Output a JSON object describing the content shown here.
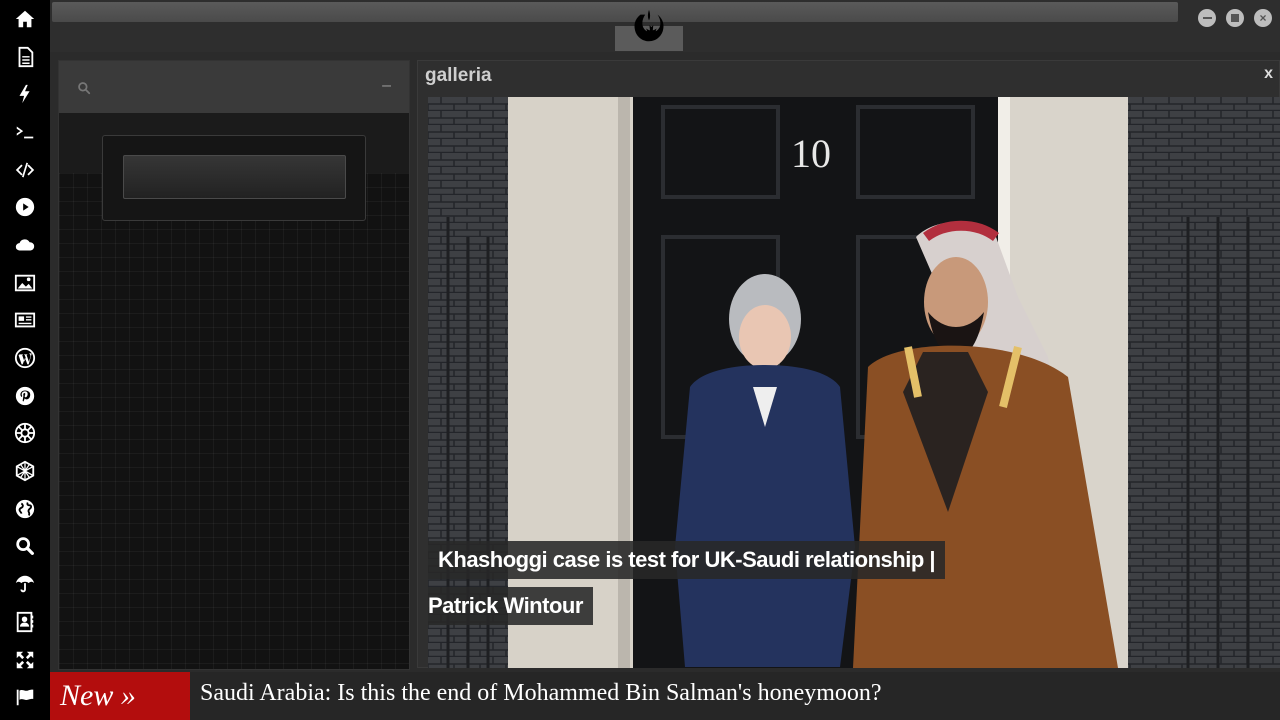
{
  "dock": {
    "items": [
      {
        "name": "home-icon"
      },
      {
        "name": "document-icon"
      },
      {
        "name": "bolt-icon"
      },
      {
        "name": "terminal-icon"
      },
      {
        "name": "code-icon"
      },
      {
        "name": "play-icon"
      },
      {
        "name": "cloud-icon"
      },
      {
        "name": "image-icon"
      },
      {
        "name": "newspaper-icon"
      },
      {
        "name": "wordpress-icon"
      },
      {
        "name": "pinterest-icon"
      },
      {
        "name": "empire-icon"
      },
      {
        "name": "network-icon"
      },
      {
        "name": "globe-icon"
      },
      {
        "name": "search-icon"
      },
      {
        "name": "umbrella-icon"
      },
      {
        "name": "contacts-icon"
      },
      {
        "name": "expand-icon"
      },
      {
        "name": "flag-icon"
      }
    ]
  },
  "topbar": {
    "logo": "rebel-alliance-icon",
    "window_controls": [
      "minimize-icon",
      "maximize-icon",
      "close-icon"
    ]
  },
  "search_panel": {
    "placeholder": "",
    "minimize_label": "–"
  },
  "gallery": {
    "title": "galleria",
    "close_label": "x",
    "caption_line1": "Khashoggi case is test for UK-Saudi relationship |",
    "caption_line2": "Patrick Wintour",
    "door_number": "10"
  },
  "ticker": {
    "badge": "New »",
    "headline": "Saudi Arabia: Is this the end of Mohammed Bin Salman's honeymoon?"
  },
  "colors": {
    "accent_red": "#b30d0d",
    "dock_bg": "#000000",
    "panel_bg": "#121212"
  }
}
